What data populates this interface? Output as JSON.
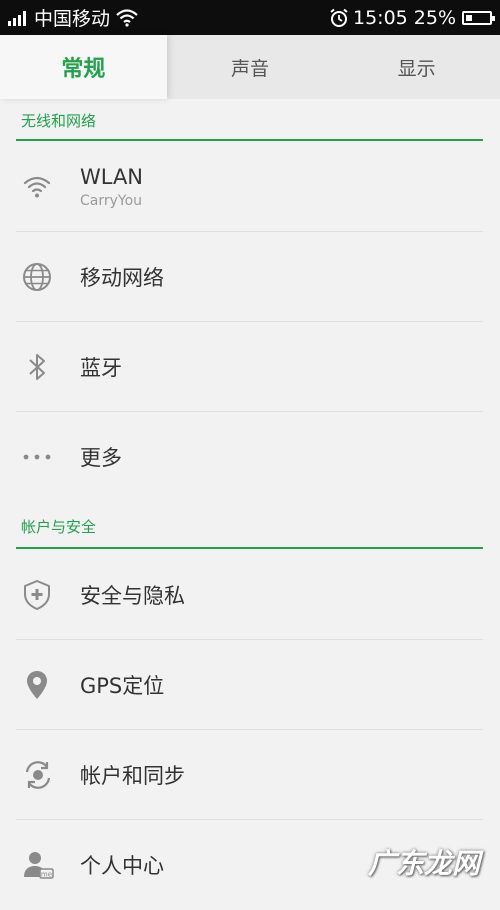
{
  "status_bar": {
    "carrier": "中国移动",
    "time": "15:05",
    "battery_percent": "25%",
    "battery_level": 0.25,
    "icons": [
      "signal-icon",
      "wifi-icon",
      "alarm-icon",
      "battery-icon"
    ]
  },
  "tabs": [
    {
      "label": "常规",
      "active": true
    },
    {
      "label": "声音",
      "active": false
    },
    {
      "label": "显示",
      "active": false
    }
  ],
  "sections": [
    {
      "header": "无线和网络",
      "items": [
        {
          "title": "WLAN",
          "subtitle": "CarryYou",
          "icon": "wifi-icon"
        },
        {
          "title": "移动网络",
          "icon": "globe-icon"
        },
        {
          "title": "蓝牙",
          "icon": "bluetooth-icon"
        },
        {
          "title": "更多",
          "icon": "more-dots-icon"
        }
      ]
    },
    {
      "header": "帐户与安全",
      "items": [
        {
          "title": "安全与隐私",
          "icon": "shield-icon"
        },
        {
          "title": "GPS定位",
          "icon": "location-pin-icon"
        },
        {
          "title": "帐户和同步",
          "icon": "sync-icon"
        },
        {
          "title": "个人中心",
          "icon": "user-icon"
        }
      ]
    }
  ],
  "watermark": "广东龙网",
  "colors": {
    "accent": "#21a24b",
    "icon": "#8a8a8a",
    "status_bar": "#0d0d0d"
  }
}
